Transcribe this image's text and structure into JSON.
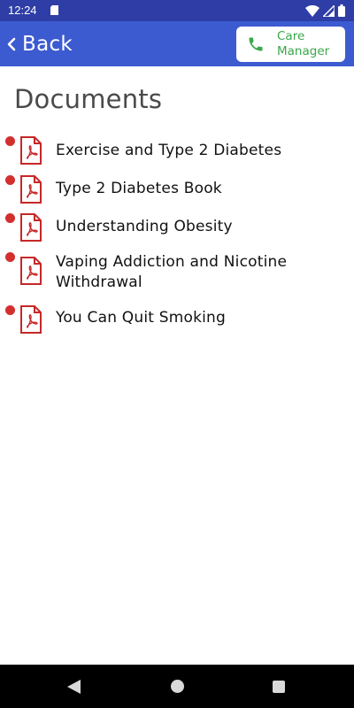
{
  "status_bar": {
    "time": "12:24",
    "icons": [
      "sd-card-icon",
      "wifi-icon",
      "signal-icon",
      "battery-icon"
    ]
  },
  "app_bar": {
    "back_label": "Back",
    "care_manager_label": "Care Manager",
    "care_manager_icon": "phone-icon"
  },
  "page": {
    "title": "Documents"
  },
  "documents": [
    {
      "title": "Exercise and Type 2 Diabetes",
      "icon": "pdf-icon",
      "unread": true
    },
    {
      "title": "Type 2 Diabetes Book",
      "icon": "pdf-icon",
      "unread": true
    },
    {
      "title": "Understanding Obesity",
      "icon": "pdf-icon",
      "unread": true
    },
    {
      "title": "Vaping Addiction and Nicotine Withdrawal",
      "icon": "pdf-icon",
      "unread": true
    },
    {
      "title": "You Can Quit Smoking",
      "icon": "pdf-icon",
      "unread": true
    }
  ],
  "nav_bar": {
    "buttons": [
      "back-icon",
      "home-icon",
      "recents-icon"
    ]
  },
  "colors": {
    "status_bar": "#2e3ea6",
    "app_bar": "#3d5bd0",
    "care_accent": "#3aa84a",
    "unread_dot": "#d32f2f",
    "pdf_red": "#c62828"
  }
}
